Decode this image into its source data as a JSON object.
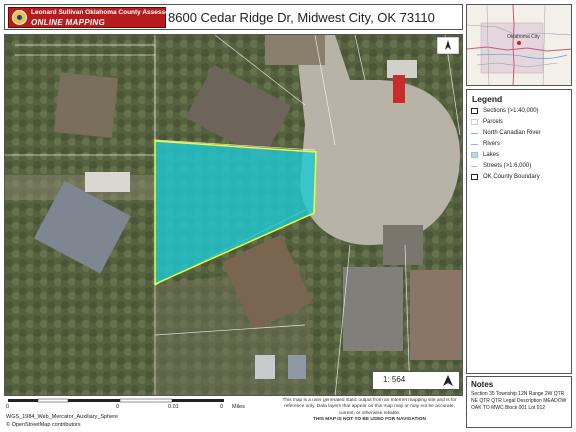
{
  "header": {
    "org_name": "Leonard Sullivan Oklahoma County Assessor",
    "org_subtitle": "ONLINE MAPPING",
    "map_title": "8600 Cedar Ridge Dr, Midwest City, OK 73110"
  },
  "overview": {
    "place_label": "Oklahoma City"
  },
  "map": {
    "scale": "1: 564",
    "colors": {
      "selected_parcel": "#20c8d2",
      "parcel_lines": "#ffffff",
      "selection_outline": "#e9ff3b"
    }
  },
  "legend": {
    "title": "Legend",
    "items": [
      {
        "label": "Sections (>1:40,000)",
        "icon": "sections-box"
      },
      {
        "label": "Parcels",
        "icon": "parcels-box"
      },
      {
        "label": "North Canadian River",
        "icon": "river-line"
      },
      {
        "label": "Rivers",
        "icon": "rivers-line"
      },
      {
        "label": "Lakes",
        "icon": "lakes-box"
      },
      {
        "label": "Streets (>1:6,000)",
        "icon": "streets-line"
      },
      {
        "label": "OK County Boundary",
        "icon": "county-box"
      }
    ]
  },
  "notes": {
    "title": "Notes",
    "text": "Section 35 Township 12N Range 2W QTR NE QTR QTR Legal Description MEADOW OAK TO MWC Block 001 Lot 012"
  },
  "footer": {
    "scalebar_labels": [
      "0",
      "0",
      "0.01",
      "0",
      "Miles"
    ],
    "crs": "WGS_1984_Web_Mercator_Auxiliary_Sphere",
    "attribution": "© OpenStreetMap contributors",
    "disclaimer": "This map is a user generated static output from an Internet mapping site and is for reference only. Data layers that appear on this map may or may not be accurate, current, or otherwise reliable.",
    "disclaimer_strong": "THIS MAP IS NOT TO BE USED FOR NAVIGATION"
  }
}
